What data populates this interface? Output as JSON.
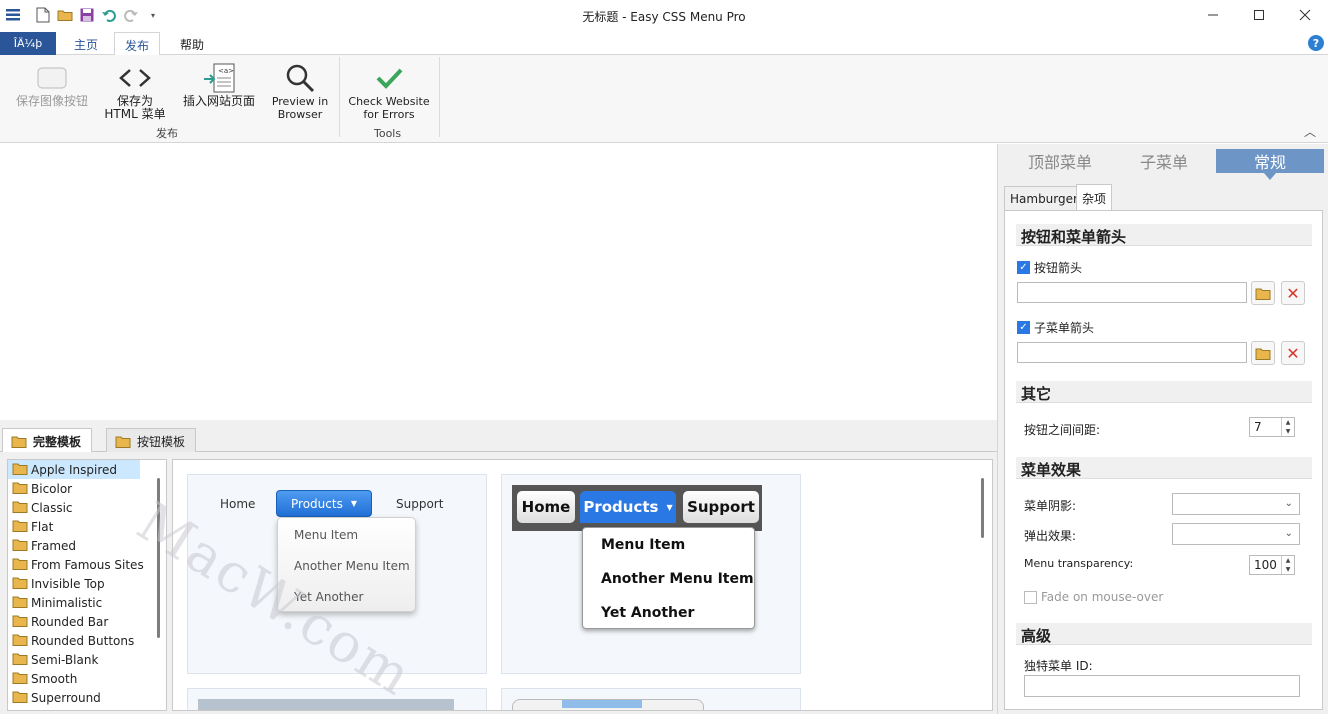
{
  "window": {
    "title": "无标题 - Easy CSS Menu Pro",
    "minimize_icon": "minimize-icon",
    "maximize_icon": "maximize-icon",
    "close_icon": "close-icon"
  },
  "ribbon_tabs": {
    "file": "ÎÄ¼þ",
    "home": "主页",
    "publish": "发布",
    "help": "帮助"
  },
  "ribbon": {
    "buttons": {
      "save_image_buttons": "保存图像按钮",
      "save_html_line1": "保存为",
      "save_html_line2": "HTML 菜单",
      "insert_page": "插入网站页面",
      "preview_line1": "Preview in",
      "preview_line2": "Browser",
      "check_line1": "Check Website",
      "check_line2": "for Errors"
    },
    "groups": {
      "publish": "发布",
      "tools": "Tools"
    }
  },
  "templates": {
    "tabs": [
      "完整模板",
      "按钮模板"
    ],
    "tree": [
      "Apple Inspired",
      "Bicolor",
      "Classic",
      "Flat",
      "Framed",
      "From Famous Sites",
      "Invisible Top",
      "Minimalistic",
      "Rounded Bar",
      "Rounded Buttons",
      "Semi-Blank",
      "Smooth",
      "Superround"
    ],
    "selected": "Apple Inspired",
    "preview1": {
      "home": "Home",
      "products": "Products",
      "support": "Support",
      "items": [
        "Menu Item",
        "Another Menu Item",
        "Yet Another"
      ]
    },
    "preview2": {
      "home": "Home",
      "products": "Products",
      "support": "Support",
      "items": [
        "Menu Item",
        "Another Menu Item",
        "Yet Another"
      ]
    },
    "watermark": "MacW.com"
  },
  "props": {
    "top_tabs": [
      "顶部菜单",
      "子菜单",
      "常规"
    ],
    "active_top_tab": "常规",
    "sub_tabs": [
      "Hamburger",
      "杂项"
    ],
    "active_sub_tab": "杂项",
    "sections": {
      "arrows": "按钮和菜单箭头",
      "other": "其它",
      "effects": "菜单效果",
      "advanced": "高级"
    },
    "button_arrow": {
      "label": "按钮箭头",
      "checked": true,
      "value": ""
    },
    "submenu_arrow": {
      "label": "子菜单箭头",
      "checked": true,
      "value": ""
    },
    "spacing": {
      "label": "按钮之间间距:",
      "value": "7"
    },
    "shadow": {
      "label": "菜单阴影:",
      "value": ""
    },
    "popup": {
      "label": "弹出效果:",
      "value": ""
    },
    "transparency": {
      "label": "Menu transparency:",
      "value": "100"
    },
    "fade": {
      "label": "Fade on mouse-over",
      "checked": false
    },
    "menu_id": {
      "label": "独特菜单 ID:",
      "value": ""
    }
  },
  "colors": {
    "accent": "#2b579a",
    "file_tab": "#2a5699",
    "active_prop_tab": "#6d95c6",
    "check_green": "#3aa55b"
  }
}
